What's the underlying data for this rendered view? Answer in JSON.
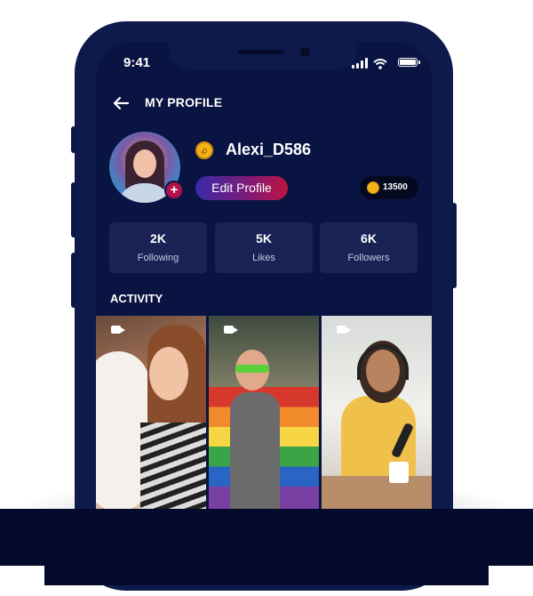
{
  "status_bar": {
    "time": "9:41"
  },
  "header": {
    "title": "MY PROFILE"
  },
  "profile": {
    "username": "Alexi_D586",
    "coin_badge_glyph": "ꝓ",
    "edit_label": "Edit Profile",
    "add_glyph": "+",
    "coins": "13500"
  },
  "stats": [
    {
      "value": "2K",
      "label": "Following"
    },
    {
      "value": "5K",
      "label": "Likes"
    },
    {
      "value": "6K",
      "label": "Followers"
    }
  ],
  "activity": {
    "title": "ACTIVITY",
    "items": [
      {
        "type": "video",
        "icon": "video-camera-icon"
      },
      {
        "type": "video",
        "icon": "video-camera-icon"
      },
      {
        "type": "video",
        "icon": "video-camera-icon"
      }
    ]
  },
  "colors": {
    "phone_frame": "#0e1a4c",
    "screen_bg": "#0a1442",
    "card_bg": "#1a2256",
    "accent_gradient_start": "#3a2aa8",
    "accent_gradient_end": "#c0133f",
    "coin_gold": "#f2b418"
  }
}
